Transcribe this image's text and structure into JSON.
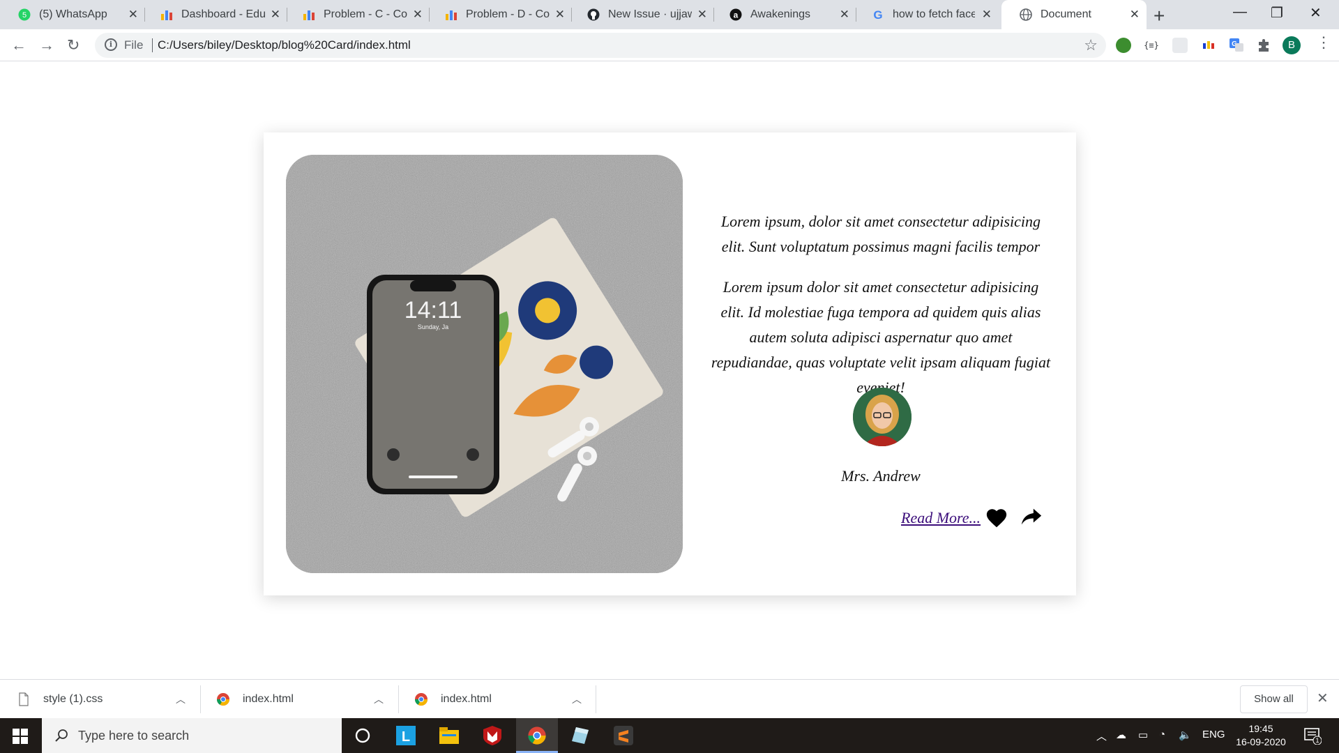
{
  "browser": {
    "tabs": [
      {
        "title": "(5) WhatsApp",
        "icon": "whatsapp-icon",
        "active": false
      },
      {
        "title": "Dashboard - Educative",
        "icon": "chart-icon",
        "active": false
      },
      {
        "title": "Problem - C - Codeforces",
        "icon": "chart-icon",
        "active": false
      },
      {
        "title": "Problem - D - Codeforces",
        "icon": "chart-icon",
        "active": false
      },
      {
        "title": "New Issue · ujjawal",
        "icon": "github-icon",
        "active": false
      },
      {
        "title": "Awakenings",
        "icon": "awakenings-icon",
        "active": false
      },
      {
        "title": "how to fetch facebook",
        "icon": "google-icon",
        "active": false
      },
      {
        "title": "Document",
        "icon": "globe-icon",
        "active": true
      }
    ],
    "address": {
      "scheme_label": "File",
      "url": "C:/Users/biley/Desktop/blog%20Card/index.html"
    },
    "profile_initial": "B",
    "whatsapp_badge": "5"
  },
  "card": {
    "intro": "Lorem ipsum, dolor sit amet consectetur adipisicing elit. Sunt voluptatum possimus magni facilis tempor",
    "body": "Lorem ipsum dolor sit amet consectetur adipisicing elit. Id molestiae fuga tempora ad quidem quis alias autem soluta adipisci aspernatur quo amet repudiandae, quas voluptate velit ipsam aliquam fugiat eveniet!",
    "author": "Mrs. Andrew",
    "read_more": "Read More...",
    "phone_time": "14:11",
    "phone_date": "Sunday, Ja",
    "like_icon": "heart-icon",
    "share_icon": "share-icon"
  },
  "downloads": {
    "items": [
      {
        "name": "style (1).css",
        "icon": "file-icon"
      },
      {
        "name": "index.html",
        "icon": "chrome-icon"
      },
      {
        "name": "index.html",
        "icon": "chrome-icon"
      }
    ],
    "show_all": "Show all"
  },
  "taskbar": {
    "search_placeholder": "Type here to search",
    "language": "ENG",
    "time": "19:45",
    "date": "16-09-2020",
    "notification_count": "1"
  },
  "colors": {
    "link": "#3b0d7a",
    "tabstrip": "#dee1e6",
    "taskbar": "#1f1b18"
  }
}
